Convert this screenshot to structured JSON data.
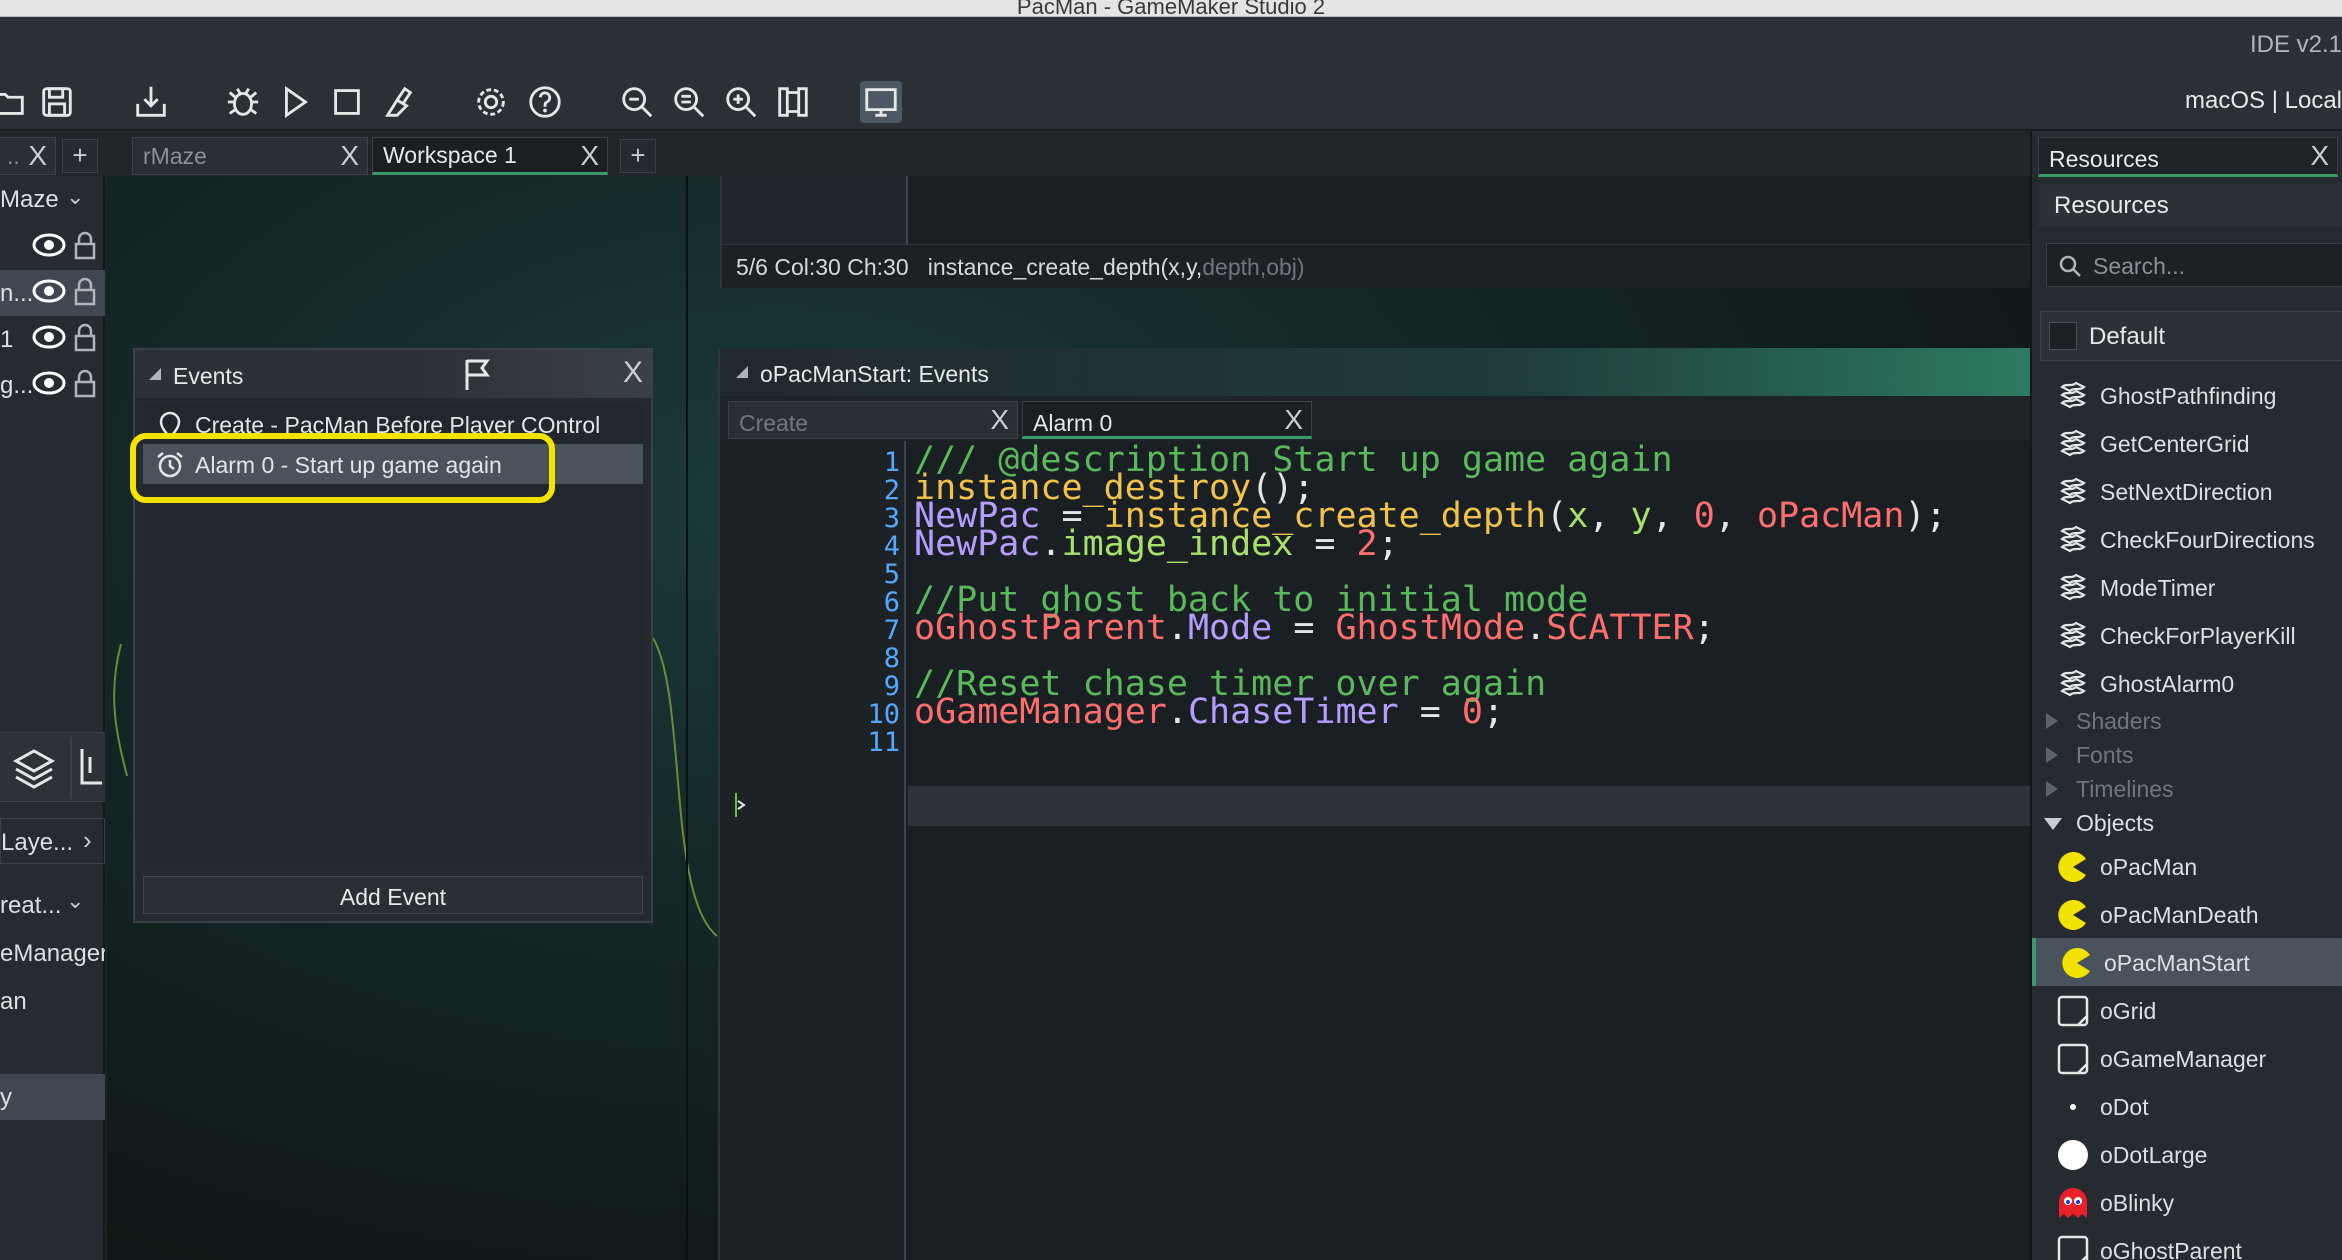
{
  "window": {
    "title": "PacMan - GameMaker Studio 2",
    "ide_version": "IDE v2.1"
  },
  "toolbar": {
    "buttons": [
      "open-icon",
      "save-icon",
      "export-icon",
      "debug-icon",
      "run-icon",
      "stop-icon",
      "clean-icon",
      "settings-icon",
      "help-icon",
      "zoom-out-icon",
      "zoom-reset-icon",
      "zoom-in-icon",
      "gamepad-icon",
      "monitor-icon"
    ],
    "platform": "macOS | Local"
  },
  "tabs": {
    "left_partial_label": "..",
    "items": [
      {
        "label": "rMaze",
        "active": false
      },
      {
        "label": "Workspace 1",
        "active": true
      }
    ],
    "close": "X",
    "add": "+"
  },
  "left_panel": {
    "layers_header": "Maze",
    "layers": [
      {
        "label": ""
      },
      {
        "label": "n...",
        "selected": true
      },
      {
        "label": "1"
      },
      {
        "label": "g..."
      }
    ],
    "layer_button": "Laye...",
    "create_dropdown": "reat...",
    "instances": [
      "eManager",
      "an",
      "y"
    ]
  },
  "code_status": {
    "position": "5/6 Col:30 Ch:30",
    "signature": "instance_create_depth(x,y,",
    "signature_dim": "depth,obj)"
  },
  "events_window": {
    "title": "Events",
    "close": "X",
    "events": [
      {
        "label": "Create - PacMan Before Player COntrol",
        "icon": "create-event-icon",
        "selected": false
      },
      {
        "label": "Alarm 0 - Start up game again",
        "icon": "alarm-clock-icon",
        "selected": true
      }
    ],
    "add_event": "Add Event"
  },
  "editor": {
    "title": "oPacManStart: Events",
    "tabs": [
      {
        "label": "Create",
        "active": false
      },
      {
        "label": "Alarm 0",
        "active": true
      }
    ],
    "close": "X",
    "current_line": 7,
    "lines": [
      {
        "n": "1",
        "t": [
          [
            "c-comment",
            "/// @description Start up game again"
          ]
        ]
      },
      {
        "n": "2",
        "t": [
          [
            "c-fn",
            "instance_destroy"
          ],
          [
            "c-def",
            "();"
          ]
        ]
      },
      {
        "n": "3",
        "t": [
          [
            "c-var",
            "NewPac"
          ],
          [
            "c-def",
            " = "
          ],
          [
            "c-fn",
            "instance_create_depth"
          ],
          [
            "c-def",
            "("
          ],
          [
            "c-arg",
            "x"
          ],
          [
            "c-def",
            ", "
          ],
          [
            "c-arg",
            "y"
          ],
          [
            "c-def",
            ", "
          ],
          [
            "c-num",
            "0"
          ],
          [
            "c-def",
            ", "
          ],
          [
            "c-obj",
            "oPacMan"
          ],
          [
            "c-def",
            ");"
          ]
        ]
      },
      {
        "n": "4",
        "t": [
          [
            "c-var",
            "NewPac"
          ],
          [
            "c-def",
            "."
          ],
          [
            "c-arg",
            "image_index"
          ],
          [
            "c-def",
            " = "
          ],
          [
            "c-num",
            "2"
          ],
          [
            "c-def",
            ";"
          ]
        ]
      },
      {
        "n": "5",
        "t": []
      },
      {
        "n": "6",
        "t": [
          [
            "c-comment",
            "//Put ghost back to initial mode"
          ]
        ]
      },
      {
        "n": "7",
        "t": [
          [
            "c-obj",
            "oGhostParent"
          ],
          [
            "c-def",
            "."
          ],
          [
            "c-var",
            "Mode"
          ],
          [
            "c-def",
            " = "
          ],
          [
            "c-obj",
            "GhostMode"
          ],
          [
            "c-def",
            "."
          ],
          [
            "c-obj",
            "SCATTER"
          ],
          [
            "c-def",
            ";"
          ]
        ]
      },
      {
        "n": "8",
        "t": []
      },
      {
        "n": "9",
        "t": [
          [
            "c-comment",
            "//Reset chase timer over again"
          ]
        ]
      },
      {
        "n": "10",
        "t": [
          [
            "c-obj",
            "oGameManager"
          ],
          [
            "c-def",
            "."
          ],
          [
            "c-var",
            "ChaseTimer"
          ],
          [
            "c-def",
            " = "
          ],
          [
            "c-num",
            "0"
          ],
          [
            "c-def",
            ";"
          ]
        ]
      },
      {
        "n": "11",
        "t": []
      }
    ]
  },
  "resources": {
    "tab_label": "Resources",
    "close": "X",
    "header": "Resources",
    "search_placeholder": "Search...",
    "group": "Default",
    "scripts": [
      "GhostPathfinding",
      "GetCenterGrid",
      "SetNextDirection",
      "CheckFourDirections",
      "ModeTimer",
      "CheckForPlayerKill",
      "GhostAlarm0"
    ],
    "folders_collapsed": [
      "Shaders",
      "Fonts",
      "Timelines"
    ],
    "objects_folder": "Objects",
    "objects": [
      {
        "label": "oPacMan",
        "icon": "pacman-icon",
        "selected": false
      },
      {
        "label": "oPacManDeath",
        "icon": "pacman-icon",
        "selected": false
      },
      {
        "label": "oPacManStart",
        "icon": "pacman-icon",
        "selected": true
      },
      {
        "label": "oGrid",
        "icon": "object-outline-icon",
        "selected": false
      },
      {
        "label": "oGameManager",
        "icon": "object-outline-icon",
        "selected": false
      },
      {
        "label": "oDot",
        "icon": "dot-icon",
        "selected": false
      },
      {
        "label": "oDotLarge",
        "icon": "large-dot-icon",
        "selected": false
      },
      {
        "label": "oBlinky",
        "icon": "ghost-icon",
        "selected": false
      },
      {
        "label": "oGhostParent",
        "icon": "object-outline-icon",
        "selected": false
      }
    ]
  },
  "colors": {
    "accent": "#3c9a6a",
    "highlight": "#f5e400",
    "line_numbers": "#54a9ff",
    "pacman": "#f2e200"
  }
}
